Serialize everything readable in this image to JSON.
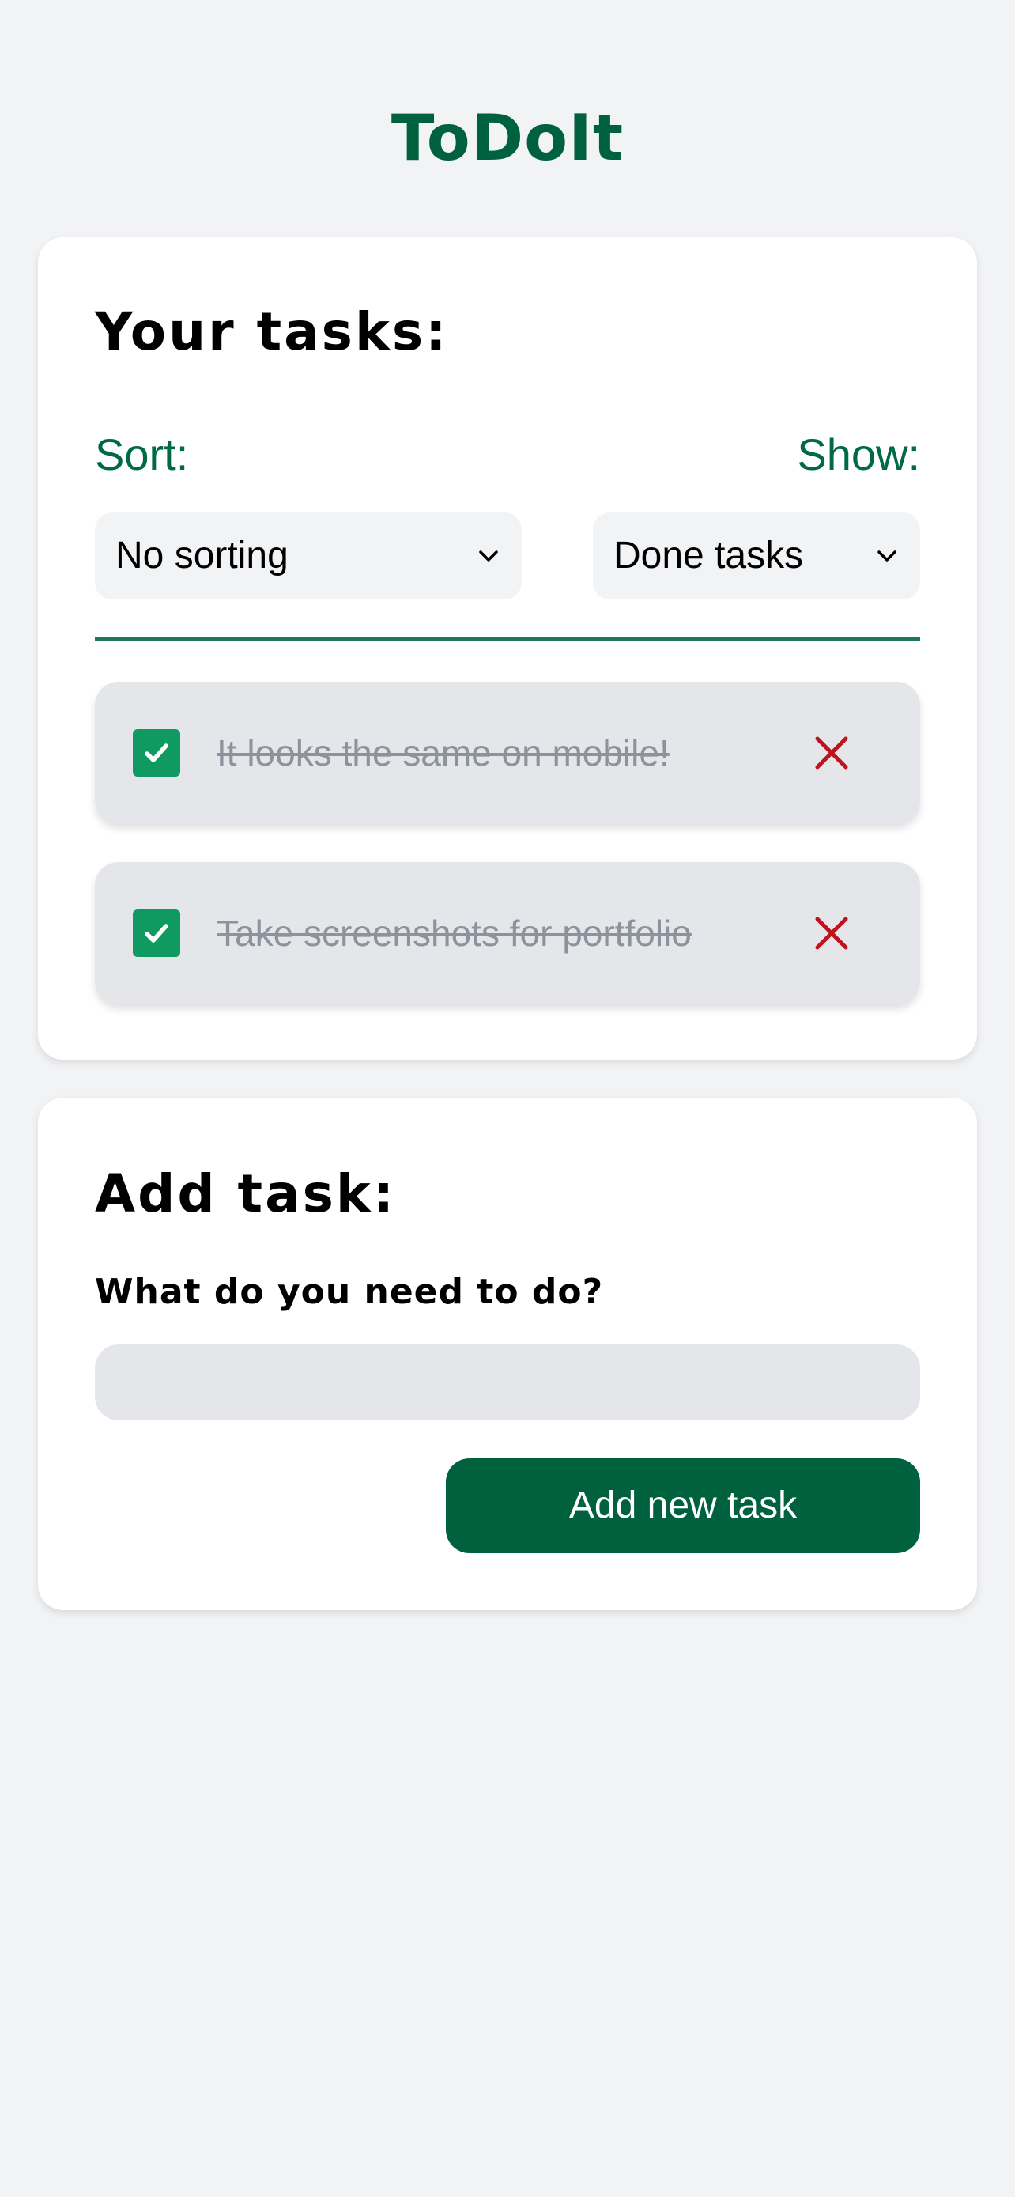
{
  "app": {
    "title": "ToDoIt"
  },
  "tasks_panel": {
    "heading": "Your tasks:",
    "sort": {
      "label": "Sort:",
      "selected": "No sorting"
    },
    "show": {
      "label": "Show:",
      "selected": "Done tasks"
    },
    "items": [
      {
        "text": "It looks the same on mobile!",
        "done": true,
        "icon": "check-icon",
        "delete_icon": "close-icon"
      },
      {
        "text": "Take screenshots for portfolio",
        "done": true,
        "icon": "check-icon",
        "delete_icon": "close-icon"
      }
    ]
  },
  "add_panel": {
    "heading": "Add task:",
    "field_label": "What do you need to do?",
    "input_value": "",
    "button_label": "Add new task"
  },
  "colors": {
    "brand": "#00613f",
    "accent_text": "#006a45",
    "checkbox": "#0f9a62",
    "delete": "#c0111f",
    "done_text": "#8d939d",
    "page_bg": "#f2f3f5"
  }
}
